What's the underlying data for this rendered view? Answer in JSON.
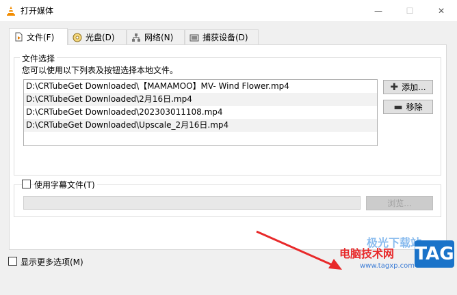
{
  "window": {
    "title": "打开媒体",
    "minimize_glyph": "—",
    "maximize_glyph": "☐",
    "close_glyph": "✕"
  },
  "tabs": [
    {
      "label": "文件(F)",
      "icon": "file-icon",
      "active": true
    },
    {
      "label": "光盘(D)",
      "icon": "disc-icon",
      "active": false
    },
    {
      "label": "网络(N)",
      "icon": "network-icon",
      "active": false
    },
    {
      "label": "捕获设备(D)",
      "icon": "capture-device-icon",
      "active": false
    }
  ],
  "file_selection": {
    "group_title": "文件选择",
    "hint": "您可以使用以下列表及按钮选择本地文件。",
    "files": [
      "D:\\CRTubeGet Downloaded\\【MAMAMOO】MV- Wind Flower.mp4",
      "D:\\CRTubeGet Downloaded\\2月16日.mp4",
      "D:\\CRTubeGet Downloaded\\202303011108.mp4",
      "D:\\CRTubeGet Downloaded\\Upscale_2月16日.mp4"
    ],
    "add_button": "添加...",
    "remove_button": "移除"
  },
  "subtitle": {
    "checkbox_label": "使用字幕文件(T)",
    "checked": false,
    "input_value": "",
    "browse_button": "浏览..."
  },
  "footer": {
    "more_options_label": "显示更多选项(M)",
    "checked": false
  },
  "watermark": {
    "site_name": "电脑技术网",
    "url": "www.tagxp.com",
    "tag": "TAG",
    "faint_text": "极光下载站"
  },
  "colors": {
    "accent_red": "#e8292a",
    "tag_blue": "#1a73c9",
    "vlc_orange": "#f28c00"
  }
}
